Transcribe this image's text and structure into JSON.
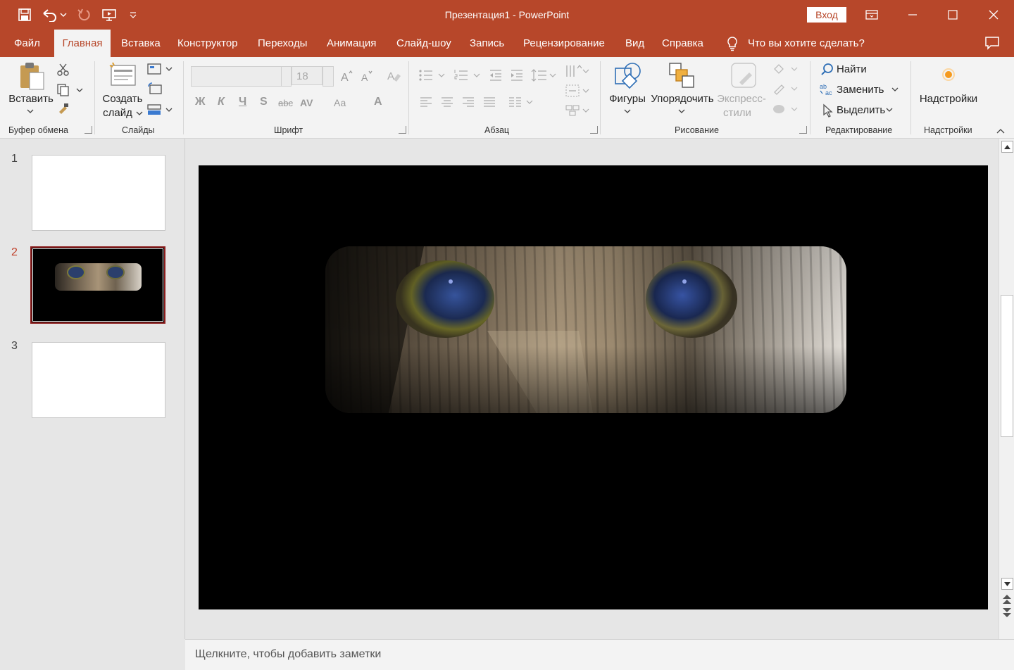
{
  "titlebar": {
    "doc_title": "Презентация1  -  PowerPoint",
    "signin": "Вход",
    "icons": [
      "save-icon",
      "undo-icon",
      "redo-icon",
      "start-from-beginning-icon",
      "customize-qat-icon",
      "ribbon-display-options-icon",
      "minimize-icon",
      "maximize-icon",
      "close-icon"
    ]
  },
  "tabs": [
    {
      "label": "Файл"
    },
    {
      "label": "Главная"
    },
    {
      "label": "Вставка"
    },
    {
      "label": "Конструктор"
    },
    {
      "label": "Переходы"
    },
    {
      "label": "Анимация"
    },
    {
      "label": "Слайд-шоу"
    },
    {
      "label": "Запись"
    },
    {
      "label": "Рецензирование"
    },
    {
      "label": "Вид"
    },
    {
      "label": "Справка"
    }
  ],
  "active_tab": "Главная",
  "tell_me": "Что вы хотите сделать?",
  "ribbon": {
    "clipboard": {
      "paste": "Вставить",
      "label": "Буфер обмена"
    },
    "slides": {
      "new_slide_line1": "Создать",
      "new_slide_line2": "слайд",
      "label": "Слайды"
    },
    "font": {
      "font_name": "",
      "font_size": "18",
      "label": "Шрифт",
      "bold": "Ж",
      "italic": "К",
      "underline": "Ч",
      "shadow": "S",
      "strike": "abc",
      "spacing": "AV",
      "case": "Аа",
      "color": "A"
    },
    "paragraph": {
      "label": "Абзац"
    },
    "drawing": {
      "shapes": "Фигуры",
      "arrange": "Упорядочить",
      "quick_styles_line1": "Экспресс-",
      "quick_styles_line2": "стили",
      "label": "Рисование"
    },
    "editing": {
      "find": "Найти",
      "replace": "Заменить",
      "select": "Выделить",
      "label": "Редактирование"
    },
    "addins": {
      "addins": "Надстройки",
      "label": "Надстройки"
    }
  },
  "slides": [
    {
      "number": "1",
      "selected": false
    },
    {
      "number": "2",
      "selected": true
    },
    {
      "number": "3",
      "selected": false
    }
  ],
  "notes_placeholder": "Щелкните, чтобы добавить заметки",
  "colors": {
    "accent": "#b7472a",
    "slide_bg": "#000000",
    "selected_thumb_border": "#8b1c1c"
  }
}
